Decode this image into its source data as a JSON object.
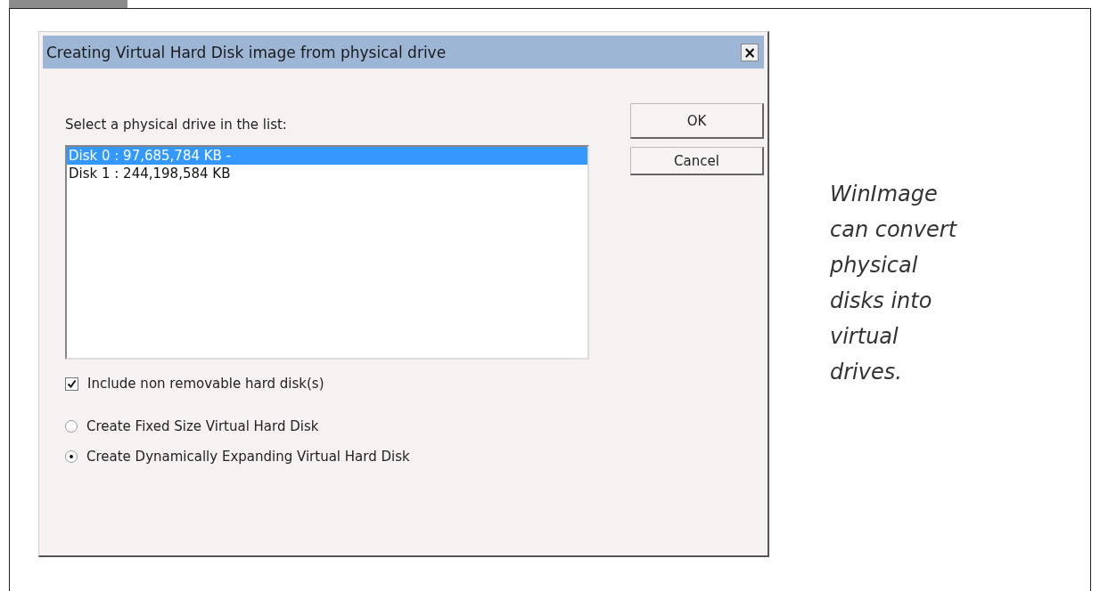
{
  "dialog": {
    "title": "Creating Virtual Hard Disk image from physical drive",
    "close": "×",
    "list_label": "Select a physical drive in the list:",
    "drives": [
      {
        "label": "Disk 0 : 97,685,784 KB -",
        "selected": true
      },
      {
        "label": "Disk 1 : 244,198,584 KB",
        "selected": false
      }
    ],
    "buttons": [
      "OK",
      "Cancel"
    ],
    "checkbox": {
      "label": "Include non removable hard disk(s)",
      "checked": true
    },
    "options": [
      {
        "label": "Create Fixed Size Virtual Hard Disk",
        "selected": false
      },
      {
        "label": "Create Dynamically Expanding Virtual Hard Disk",
        "selected": true
      }
    ]
  },
  "caption": "WinImage can convert physical disks into virtual drives."
}
